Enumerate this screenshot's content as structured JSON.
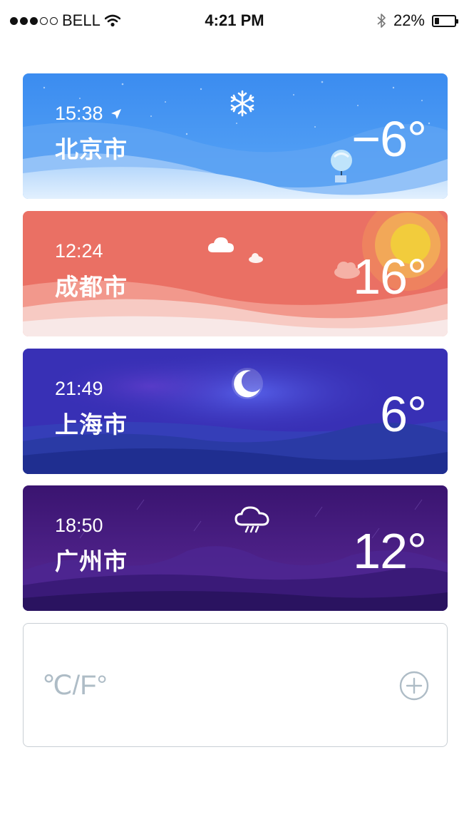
{
  "status_bar": {
    "carrier": "BELL",
    "time": "4:21 PM",
    "battery_percent": "22%",
    "battery_level": 0.22,
    "signal_bars_filled": 3,
    "signal_bars_total": 5,
    "icons": [
      "wifi-icon",
      "bluetooth-icon",
      "battery-icon"
    ]
  },
  "cities": [
    {
      "time": "15:38",
      "city": "北京市",
      "temp": "−6°",
      "weather_icon": "snowflake-icon",
      "is_current_location": true,
      "theme": "#3a8ff0"
    },
    {
      "time": "12:24",
      "city": "成都市",
      "temp": "16°",
      "weather_icon": "cloud-icon",
      "is_current_location": false,
      "theme": "#ec7464"
    },
    {
      "time": "21:49",
      "city": "上海市",
      "temp": "6°",
      "weather_icon": "moon-icon",
      "is_current_location": false,
      "theme": "#3a31b8"
    },
    {
      "time": "18:50",
      "city": "广州市",
      "temp": "12°",
      "weather_icon": "rain-cloud-icon",
      "is_current_location": false,
      "theme": "#3a1470"
    }
  ],
  "add_card": {
    "unit_toggle": "℃/F°",
    "add_icon": "plus-circle-icon"
  }
}
